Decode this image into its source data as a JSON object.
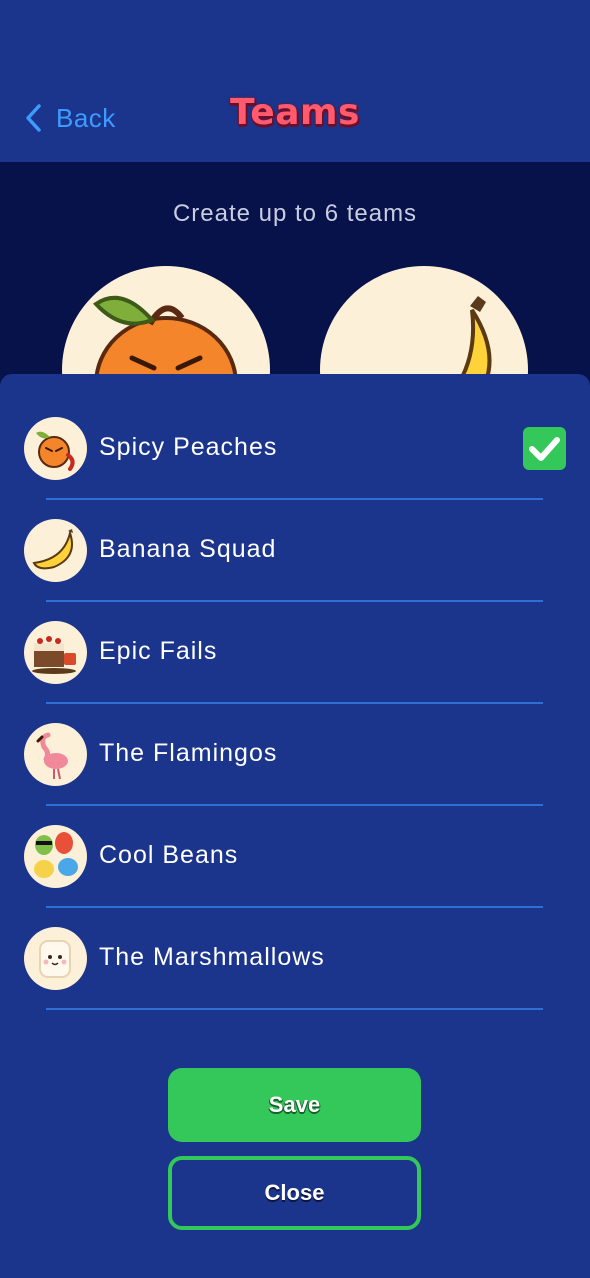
{
  "header": {
    "back_label": "Back",
    "title": "Teams"
  },
  "intro": {
    "subtitle": "Create up to 6 teams"
  },
  "teams": [
    {
      "name": "Spicy Peaches",
      "icon": "peach-icon",
      "selected": true
    },
    {
      "name": "Banana Squad",
      "icon": "banana-icon",
      "selected": false
    },
    {
      "name": "Epic Fails",
      "icon": "cake-icon",
      "selected": false
    },
    {
      "name": "The Flamingos",
      "icon": "flamingo-icon",
      "selected": false
    },
    {
      "name": "Cool Beans",
      "icon": "beans-icon",
      "selected": false
    },
    {
      "name": "The Marshmallows",
      "icon": "marshmallow-icon",
      "selected": false
    }
  ],
  "actions": {
    "save_label": "Save",
    "close_label": "Close"
  },
  "colors": {
    "header_bg": "#1b348c",
    "page_bg": "#07114a",
    "accent_green": "#34c759",
    "link_blue": "#3d9bff",
    "title_pink": "#ff5a6e"
  }
}
